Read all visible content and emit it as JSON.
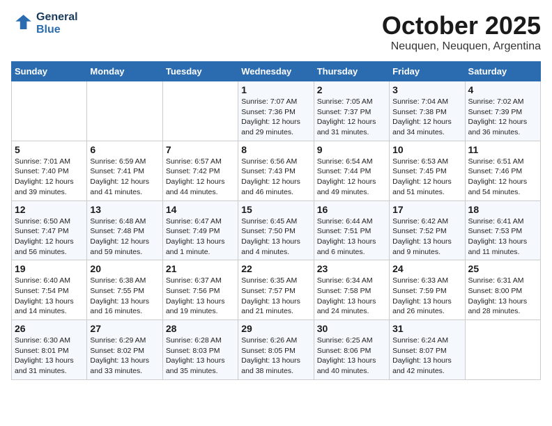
{
  "header": {
    "logo_line1": "General",
    "logo_line2": "Blue",
    "month": "October 2025",
    "location": "Neuquen, Neuquen, Argentina"
  },
  "days_of_week": [
    "Sunday",
    "Monday",
    "Tuesday",
    "Wednesday",
    "Thursday",
    "Friday",
    "Saturday"
  ],
  "weeks": [
    [
      {
        "day": "",
        "info": ""
      },
      {
        "day": "",
        "info": ""
      },
      {
        "day": "",
        "info": ""
      },
      {
        "day": "1",
        "info": "Sunrise: 7:07 AM\nSunset: 7:36 PM\nDaylight: 12 hours\nand 29 minutes."
      },
      {
        "day": "2",
        "info": "Sunrise: 7:05 AM\nSunset: 7:37 PM\nDaylight: 12 hours\nand 31 minutes."
      },
      {
        "day": "3",
        "info": "Sunrise: 7:04 AM\nSunset: 7:38 PM\nDaylight: 12 hours\nand 34 minutes."
      },
      {
        "day": "4",
        "info": "Sunrise: 7:02 AM\nSunset: 7:39 PM\nDaylight: 12 hours\nand 36 minutes."
      }
    ],
    [
      {
        "day": "5",
        "info": "Sunrise: 7:01 AM\nSunset: 7:40 PM\nDaylight: 12 hours\nand 39 minutes."
      },
      {
        "day": "6",
        "info": "Sunrise: 6:59 AM\nSunset: 7:41 PM\nDaylight: 12 hours\nand 41 minutes."
      },
      {
        "day": "7",
        "info": "Sunrise: 6:57 AM\nSunset: 7:42 PM\nDaylight: 12 hours\nand 44 minutes."
      },
      {
        "day": "8",
        "info": "Sunrise: 6:56 AM\nSunset: 7:43 PM\nDaylight: 12 hours\nand 46 minutes."
      },
      {
        "day": "9",
        "info": "Sunrise: 6:54 AM\nSunset: 7:44 PM\nDaylight: 12 hours\nand 49 minutes."
      },
      {
        "day": "10",
        "info": "Sunrise: 6:53 AM\nSunset: 7:45 PM\nDaylight: 12 hours\nand 51 minutes."
      },
      {
        "day": "11",
        "info": "Sunrise: 6:51 AM\nSunset: 7:46 PM\nDaylight: 12 hours\nand 54 minutes."
      }
    ],
    [
      {
        "day": "12",
        "info": "Sunrise: 6:50 AM\nSunset: 7:47 PM\nDaylight: 12 hours\nand 56 minutes."
      },
      {
        "day": "13",
        "info": "Sunrise: 6:48 AM\nSunset: 7:48 PM\nDaylight: 12 hours\nand 59 minutes."
      },
      {
        "day": "14",
        "info": "Sunrise: 6:47 AM\nSunset: 7:49 PM\nDaylight: 13 hours\nand 1 minute."
      },
      {
        "day": "15",
        "info": "Sunrise: 6:45 AM\nSunset: 7:50 PM\nDaylight: 13 hours\nand 4 minutes."
      },
      {
        "day": "16",
        "info": "Sunrise: 6:44 AM\nSunset: 7:51 PM\nDaylight: 13 hours\nand 6 minutes."
      },
      {
        "day": "17",
        "info": "Sunrise: 6:42 AM\nSunset: 7:52 PM\nDaylight: 13 hours\nand 9 minutes."
      },
      {
        "day": "18",
        "info": "Sunrise: 6:41 AM\nSunset: 7:53 PM\nDaylight: 13 hours\nand 11 minutes."
      }
    ],
    [
      {
        "day": "19",
        "info": "Sunrise: 6:40 AM\nSunset: 7:54 PM\nDaylight: 13 hours\nand 14 minutes."
      },
      {
        "day": "20",
        "info": "Sunrise: 6:38 AM\nSunset: 7:55 PM\nDaylight: 13 hours\nand 16 minutes."
      },
      {
        "day": "21",
        "info": "Sunrise: 6:37 AM\nSunset: 7:56 PM\nDaylight: 13 hours\nand 19 minutes."
      },
      {
        "day": "22",
        "info": "Sunrise: 6:35 AM\nSunset: 7:57 PM\nDaylight: 13 hours\nand 21 minutes."
      },
      {
        "day": "23",
        "info": "Sunrise: 6:34 AM\nSunset: 7:58 PM\nDaylight: 13 hours\nand 24 minutes."
      },
      {
        "day": "24",
        "info": "Sunrise: 6:33 AM\nSunset: 7:59 PM\nDaylight: 13 hours\nand 26 minutes."
      },
      {
        "day": "25",
        "info": "Sunrise: 6:31 AM\nSunset: 8:00 PM\nDaylight: 13 hours\nand 28 minutes."
      }
    ],
    [
      {
        "day": "26",
        "info": "Sunrise: 6:30 AM\nSunset: 8:01 PM\nDaylight: 13 hours\nand 31 minutes."
      },
      {
        "day": "27",
        "info": "Sunrise: 6:29 AM\nSunset: 8:02 PM\nDaylight: 13 hours\nand 33 minutes."
      },
      {
        "day": "28",
        "info": "Sunrise: 6:28 AM\nSunset: 8:03 PM\nDaylight: 13 hours\nand 35 minutes."
      },
      {
        "day": "29",
        "info": "Sunrise: 6:26 AM\nSunset: 8:05 PM\nDaylight: 13 hours\nand 38 minutes."
      },
      {
        "day": "30",
        "info": "Sunrise: 6:25 AM\nSunset: 8:06 PM\nDaylight: 13 hours\nand 40 minutes."
      },
      {
        "day": "31",
        "info": "Sunrise: 6:24 AM\nSunset: 8:07 PM\nDaylight: 13 hours\nand 42 minutes."
      },
      {
        "day": "",
        "info": ""
      }
    ]
  ]
}
